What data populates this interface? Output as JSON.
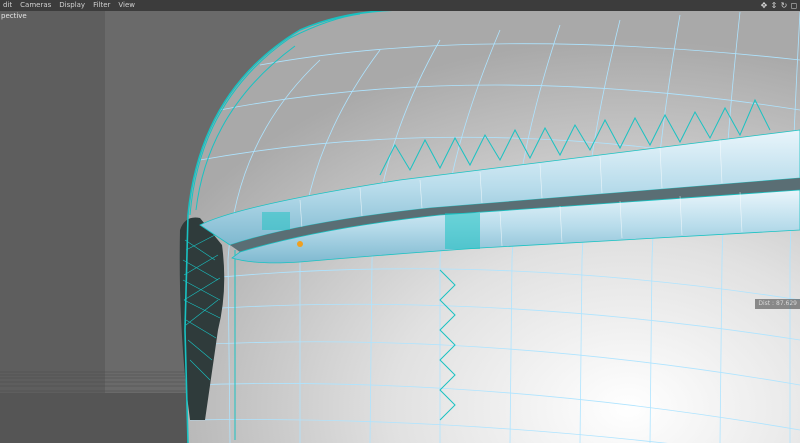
{
  "menu": {
    "items": [
      "dit",
      "Cameras",
      "Display",
      "Filter",
      "View"
    ]
  },
  "nav_icons": [
    "move-icon",
    "zoom-icon",
    "rotate-icon",
    "maximize-icon"
  ],
  "viewport": {
    "label": "pective"
  },
  "hud": {
    "distance_label": "Dist :",
    "distance_value": "87.629"
  },
  "colors": {
    "wire_cyan": "#19c2c2",
    "wire_light": "#aee4ff",
    "background": "#6a6a6a",
    "surface": "#d9d9d9",
    "menubar": "#3c3c3c"
  }
}
